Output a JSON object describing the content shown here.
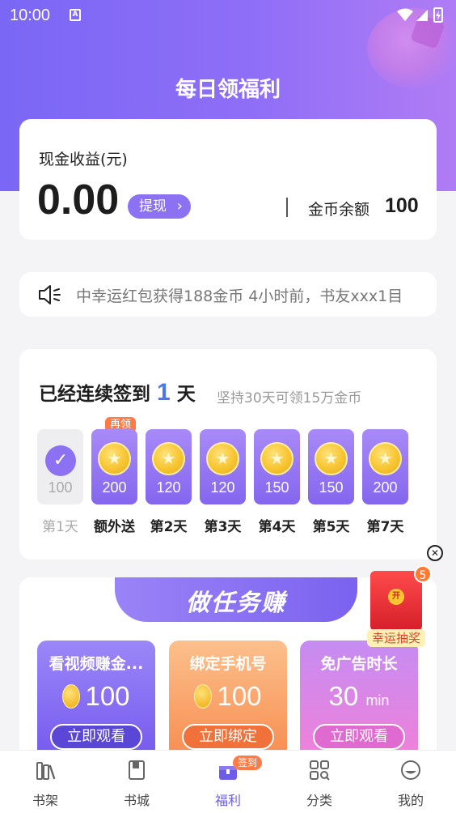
{
  "status_bar": {
    "time": "10:00",
    "notif_icon": "A"
  },
  "page_title": "每日领福利",
  "earnings": {
    "label": "现金收益(元)",
    "value": "0.00",
    "withdraw_label": "提现",
    "coin_balance_label": "金币余额",
    "coin_balance_value": "100"
  },
  "notice": {
    "text": "中幸运红包获得188金币  4小时前，书友xxx1目"
  },
  "sign_in": {
    "title_prefix": "已经连续签到",
    "days": "1",
    "title_suffix": "天",
    "subtitle": "坚持30天可领15万金币",
    "again_tag": "再领",
    "items": [
      {
        "amount": "100",
        "label": "第1天",
        "done": true
      },
      {
        "amount": "200",
        "label": "额外送",
        "done": false
      },
      {
        "amount": "120",
        "label": "第2天",
        "done": false
      },
      {
        "amount": "120",
        "label": "第3天",
        "done": false
      },
      {
        "amount": "150",
        "label": "第4天",
        "done": false
      },
      {
        "amount": "150",
        "label": "第5天",
        "done": false
      },
      {
        "amount": "200",
        "label": "第7天",
        "done": false
      }
    ]
  },
  "tasks": {
    "banner_title": "做任务赚",
    "items": [
      {
        "title": "看视频赚金...",
        "reward": "100",
        "unit": "",
        "button": "立即观看"
      },
      {
        "title": "绑定手机号",
        "reward": "100",
        "unit": "",
        "button": "立即绑定"
      },
      {
        "title": "免广告时长",
        "reward": "30",
        "unit": "min",
        "button": "立即观看"
      }
    ]
  },
  "lucky_draw": {
    "seal": "开",
    "badge": "5",
    "label": "幸运抽奖"
  },
  "bottom_nav": [
    {
      "label": "书架",
      "icon": "bookshelf-icon"
    },
    {
      "label": "书城",
      "icon": "book-icon"
    },
    {
      "label": "福利",
      "icon": "gift-icon",
      "tag": "签到",
      "active": true
    },
    {
      "label": "分类",
      "icon": "category-icon"
    },
    {
      "label": "我的",
      "icon": "profile-icon"
    }
  ],
  "colors": {
    "accent": "#8c72f2",
    "orange": "#ff7a45",
    "blue_number": "#4a78f0"
  }
}
